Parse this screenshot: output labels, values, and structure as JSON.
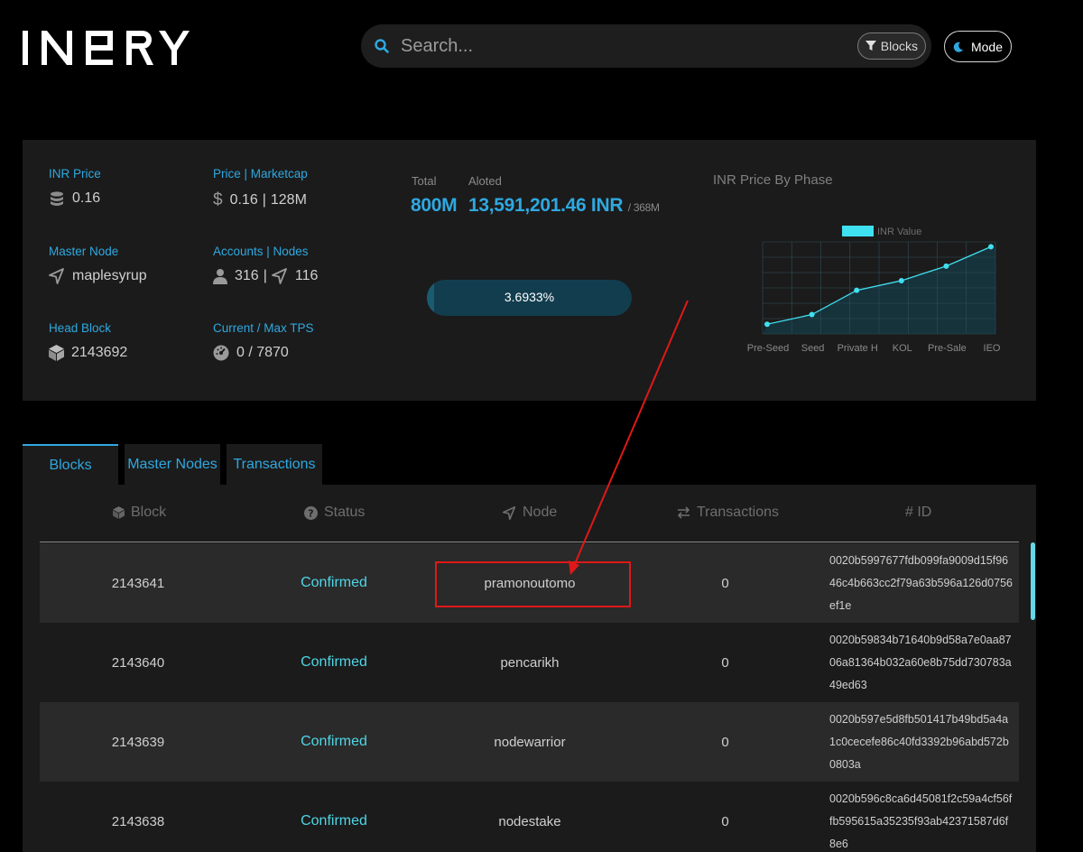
{
  "header": {
    "brand": "INERY",
    "search_placeholder": "Search...",
    "filter_label": "Blocks",
    "mode_label": "Mode"
  },
  "stats": {
    "inr_price": {
      "label": "INR Price",
      "value": "0.16"
    },
    "price_marketcap": {
      "label": "Price | Marketcap",
      "price": "0.16",
      "marketcap": "128M"
    },
    "master_node": {
      "label": "Master Node",
      "value": "maplesyrup"
    },
    "accounts_nodes": {
      "label": "Accounts | Nodes",
      "accounts": "316",
      "nodes": "116"
    },
    "head_block": {
      "label": "Head Block",
      "value": "2143692"
    },
    "tps": {
      "label": "Current / Max TPS",
      "value": "0 / 7870"
    },
    "total": {
      "label": "Total",
      "value": "800M"
    },
    "aloted": {
      "label": "Aloted",
      "value": "13,591,201.46 INR",
      "of": "/ 368M"
    },
    "progress": {
      "text": "3.6933%",
      "value_pct": 3.6933
    }
  },
  "chart_data": {
    "type": "line",
    "title": "INR Price By Phase",
    "categories": [
      "Pre-Seed",
      "Seed",
      "Private H",
      "KOL",
      "Pre-Sale",
      "IEO"
    ],
    "series": [
      {
        "name": "INR Value",
        "values": [
          0.04,
          0.05,
          0.075,
          0.085,
          0.1,
          0.12
        ]
      }
    ],
    "ylim": [
      0.03,
      0.125
    ],
    "grid": true,
    "legend": "top-center",
    "line_color": "#3fe0f0"
  },
  "tabs": [
    {
      "label": "Blocks"
    },
    {
      "label": "Master Nodes"
    },
    {
      "label": "Transactions"
    }
  ],
  "table": {
    "columns": [
      "Block",
      "Status",
      "Node",
      "Transactions",
      "# ID"
    ],
    "rows": [
      {
        "block": "2143641",
        "status": "Confirmed",
        "node": "pramonoutomo",
        "transactions": "0",
        "id": "0020b5997677fdb099fa9009d15f9646c4b663cc2f79a63b596a126d0756ef1e"
      },
      {
        "block": "2143640",
        "status": "Confirmed",
        "node": "pencarikh",
        "transactions": "0",
        "id": "0020b59834b71640b9d58a7e0aa8706a81364b032a60e8b75dd730783a49ed63"
      },
      {
        "block": "2143639",
        "status": "Confirmed",
        "node": "nodewarrior",
        "transactions": "0",
        "id": "0020b597e5d8fb501417b49bd5a4a1c0cecefe86c40fd3392b96abd572b0803a"
      },
      {
        "block": "2143638",
        "status": "Confirmed",
        "node": "nodestake",
        "transactions": "0",
        "id": "0020b596c8ca6d45081f2c59a4cf56ffb595615a35235f93ab42371587d6f8e6"
      }
    ]
  },
  "colors": {
    "accent": "#2fa8e0",
    "status_confirmed": "#4fd6e6",
    "annotation": "#e01818"
  }
}
